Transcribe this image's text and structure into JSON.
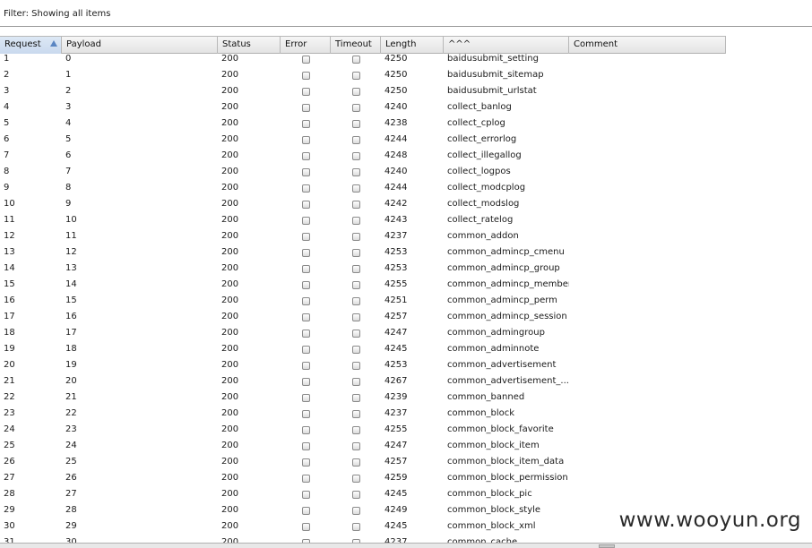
{
  "filter": {
    "text": "Filter: Showing all items"
  },
  "columns": [
    {
      "key": "request",
      "label": "Request",
      "sorted": true
    },
    {
      "key": "payload",
      "label": "Payload"
    },
    {
      "key": "status",
      "label": "Status"
    },
    {
      "key": "error",
      "label": "Error"
    },
    {
      "key": "timeout",
      "label": "Timeout"
    },
    {
      "key": "length",
      "label": "Length"
    },
    {
      "key": "extract",
      "label": "^^^"
    },
    {
      "key": "comment",
      "label": "Comment"
    }
  ],
  "rows": [
    {
      "request": "1",
      "payload": "0",
      "status": "200",
      "length": "4250",
      "extract": "baidusubmit_setting",
      "comment": ""
    },
    {
      "request": "2",
      "payload": "1",
      "status": "200",
      "length": "4250",
      "extract": "baidusubmit_sitemap",
      "comment": ""
    },
    {
      "request": "3",
      "payload": "2",
      "status": "200",
      "length": "4250",
      "extract": "baidusubmit_urlstat",
      "comment": ""
    },
    {
      "request": "4",
      "payload": "3",
      "status": "200",
      "length": "4240",
      "extract": "collect_banlog",
      "comment": ""
    },
    {
      "request": "5",
      "payload": "4",
      "status": "200",
      "length": "4238",
      "extract": "collect_cplog",
      "comment": ""
    },
    {
      "request": "6",
      "payload": "5",
      "status": "200",
      "length": "4244",
      "extract": "collect_errorlog",
      "comment": ""
    },
    {
      "request": "7",
      "payload": "6",
      "status": "200",
      "length": "4248",
      "extract": "collect_illegallog",
      "comment": ""
    },
    {
      "request": "8",
      "payload": "7",
      "status": "200",
      "length": "4240",
      "extract": "collect_logpos",
      "comment": ""
    },
    {
      "request": "9",
      "payload": "8",
      "status": "200",
      "length": "4244",
      "extract": "collect_modcplog",
      "comment": ""
    },
    {
      "request": "10",
      "payload": "9",
      "status": "200",
      "length": "4242",
      "extract": "collect_modslog",
      "comment": ""
    },
    {
      "request": "11",
      "payload": "10",
      "status": "200",
      "length": "4243",
      "extract": "collect_ratelog",
      "comment": ""
    },
    {
      "request": "12",
      "payload": "11",
      "status": "200",
      "length": "4237",
      "extract": "common_addon",
      "comment": ""
    },
    {
      "request": "13",
      "payload": "12",
      "status": "200",
      "length": "4253",
      "extract": "common_admincp_cmenu",
      "comment": ""
    },
    {
      "request": "14",
      "payload": "13",
      "status": "200",
      "length": "4253",
      "extract": "common_admincp_group",
      "comment": ""
    },
    {
      "request": "15",
      "payload": "14",
      "status": "200",
      "length": "4255",
      "extract": "common_admincp_member",
      "comment": ""
    },
    {
      "request": "16",
      "payload": "15",
      "status": "200",
      "length": "4251",
      "extract": "common_admincp_perm",
      "comment": ""
    },
    {
      "request": "17",
      "payload": "16",
      "status": "200",
      "length": "4257",
      "extract": "common_admincp_session",
      "comment": ""
    },
    {
      "request": "18",
      "payload": "17",
      "status": "200",
      "length": "4247",
      "extract": "common_admingroup",
      "comment": ""
    },
    {
      "request": "19",
      "payload": "18",
      "status": "200",
      "length": "4245",
      "extract": "common_adminnote",
      "comment": ""
    },
    {
      "request": "20",
      "payload": "19",
      "status": "200",
      "length": "4253",
      "extract": "common_advertisement",
      "comment": ""
    },
    {
      "request": "21",
      "payload": "20",
      "status": "200",
      "length": "4267",
      "extract": "common_advertisement_...",
      "comment": ""
    },
    {
      "request": "22",
      "payload": "21",
      "status": "200",
      "length": "4239",
      "extract": "common_banned",
      "comment": ""
    },
    {
      "request": "23",
      "payload": "22",
      "status": "200",
      "length": "4237",
      "extract": "common_block",
      "comment": ""
    },
    {
      "request": "24",
      "payload": "23",
      "status": "200",
      "length": "4255",
      "extract": "common_block_favorite",
      "comment": ""
    },
    {
      "request": "25",
      "payload": "24",
      "status": "200",
      "length": "4247",
      "extract": "common_block_item",
      "comment": ""
    },
    {
      "request": "26",
      "payload": "25",
      "status": "200",
      "length": "4257",
      "extract": "common_block_item_data",
      "comment": ""
    },
    {
      "request": "27",
      "payload": "26",
      "status": "200",
      "length": "4259",
      "extract": "common_block_permission",
      "comment": ""
    },
    {
      "request": "28",
      "payload": "27",
      "status": "200",
      "length": "4245",
      "extract": "common_block_pic",
      "comment": ""
    },
    {
      "request": "29",
      "payload": "28",
      "status": "200",
      "length": "4249",
      "extract": "common_block_style",
      "comment": ""
    },
    {
      "request": "30",
      "payload": "29",
      "status": "200",
      "length": "4245",
      "extract": "common_block_xml",
      "comment": ""
    },
    {
      "request": "31",
      "payload": "30",
      "status": "200",
      "length": "4237",
      "extract": "common_cache",
      "comment": ""
    }
  ],
  "watermark": "www.wooyun.org"
}
